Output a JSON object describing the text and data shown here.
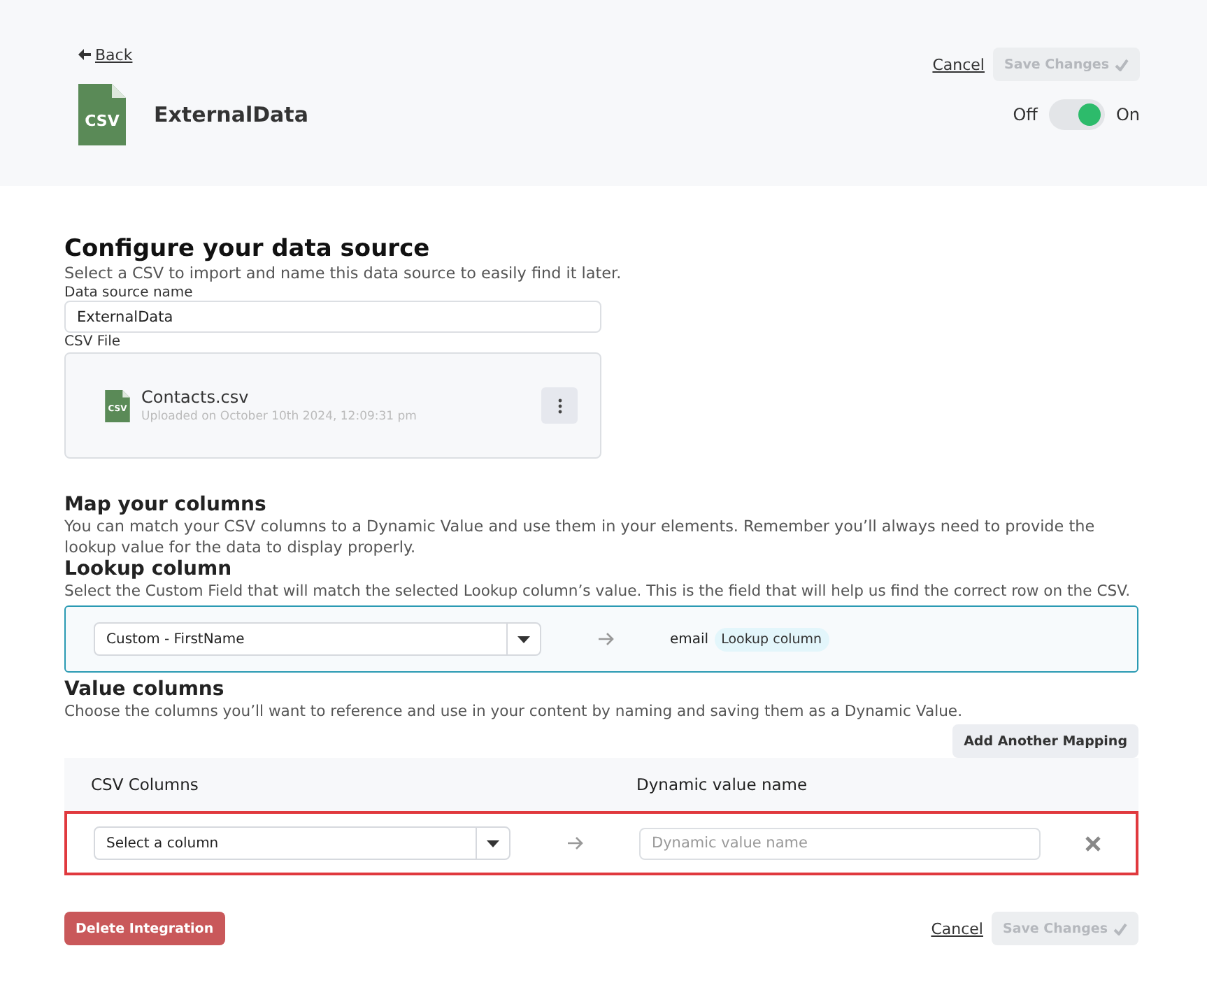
{
  "header": {
    "back_link": "Back",
    "cancel_link": "Cancel",
    "save_button": {
      "label": "Save Changes",
      "disabled": true
    },
    "title": "ExternalData",
    "file_icon_label": "CSV",
    "toggle": {
      "off_label": "Off",
      "on_label": "On",
      "on": true
    }
  },
  "configure": {
    "title": "Configure your data source",
    "description": "Select a CSV to import and name this data source to easily find it later.",
    "name_label": "Data source name",
    "name_value": "ExternalData",
    "file_label": "CSV File",
    "file": {
      "icon_label": "CSV",
      "name": "Contacts.csv",
      "uploaded": "Uploaded on October 10th 2024, 12:09:31 pm"
    }
  },
  "map": {
    "title": "Map your columns",
    "description": "You can match your CSV columns to a Dynamic Value and use them in your elements. Remember you’ll always need to provide the lookup value for the data to display properly."
  },
  "lookup": {
    "title": "Lookup column",
    "description": "Select the Custom Field that will match the selected Lookup column’s value. This is the field that will help us find the correct row on the CSV.",
    "select_value": "Custom - FirstName",
    "column": "email",
    "badge": "Lookup column"
  },
  "values": {
    "title": "Value columns",
    "description": "Choose the columns you’ll want to reference and use in your content by naming and saving them as a Dynamic Value.",
    "add_button": "Add Another Mapping",
    "columns": [
      "CSV Columns",
      "Dynamic value name"
    ],
    "rows": [
      {
        "select_placeholder": "Select a column",
        "name_placeholder": "Dynamic value name",
        "invalid": true
      }
    ]
  },
  "footer": {
    "delete_button": "Delete Integration",
    "cancel_link": "Cancel",
    "save_button": {
      "label": "Save Changes",
      "disabled": true
    }
  }
}
